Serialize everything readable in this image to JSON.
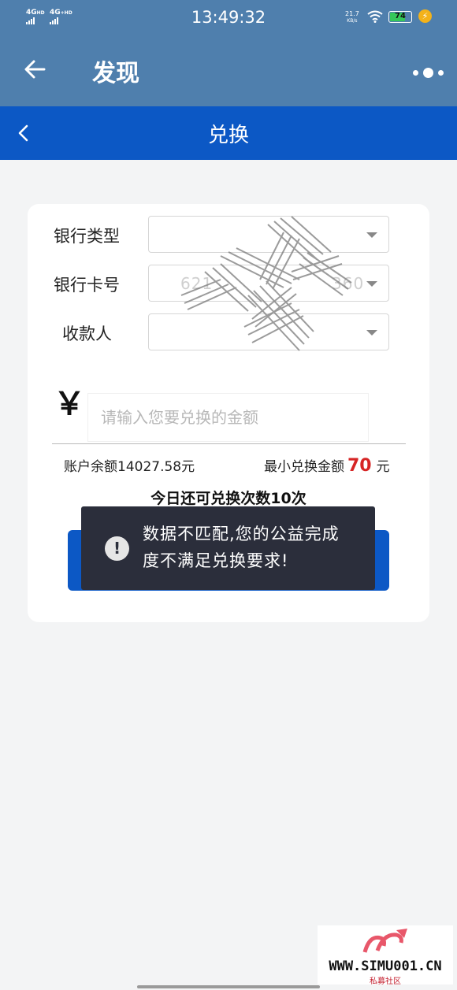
{
  "status_bar": {
    "sim1": "4G",
    "sim1_sup": "HD",
    "sim2": "4G",
    "sim2_sup": "+HD",
    "time": "13:49:32",
    "net_speed_value": "21.7",
    "net_speed_unit": "KB/s",
    "battery_level": "74",
    "battery_fraction": 0.74
  },
  "app_bar": {
    "title": "发现"
  },
  "sub_header": {
    "title": "兑换"
  },
  "form": {
    "bank_type_label": "银行类型",
    "card_number_label": "银行卡号",
    "card_number_value_start": "621",
    "card_number_value_end": "360",
    "payee_label": "收款人"
  },
  "amount": {
    "currency_symbol": "￥",
    "placeholder": "请输入您要兑换的金额",
    "balance_text": "账户余额14027.58元",
    "min_label": "最小兑换金额",
    "min_value": "70",
    "min_unit": "元",
    "remaining_text": "今日还可兑换次数10次"
  },
  "toast": {
    "icon": "!",
    "message_line1": "数据不匹配,您的公益完成",
    "message_line2": "度不满足兑换要求!"
  },
  "watermark": {
    "url": "WWW.SIMU001.CN",
    "subtitle": "私募社区"
  },
  "colors": {
    "app_bar": "#4f7fad",
    "sub_header": "#0c58c5",
    "accent_red": "#d62525",
    "toast_bg": "#2b2e3b"
  }
}
